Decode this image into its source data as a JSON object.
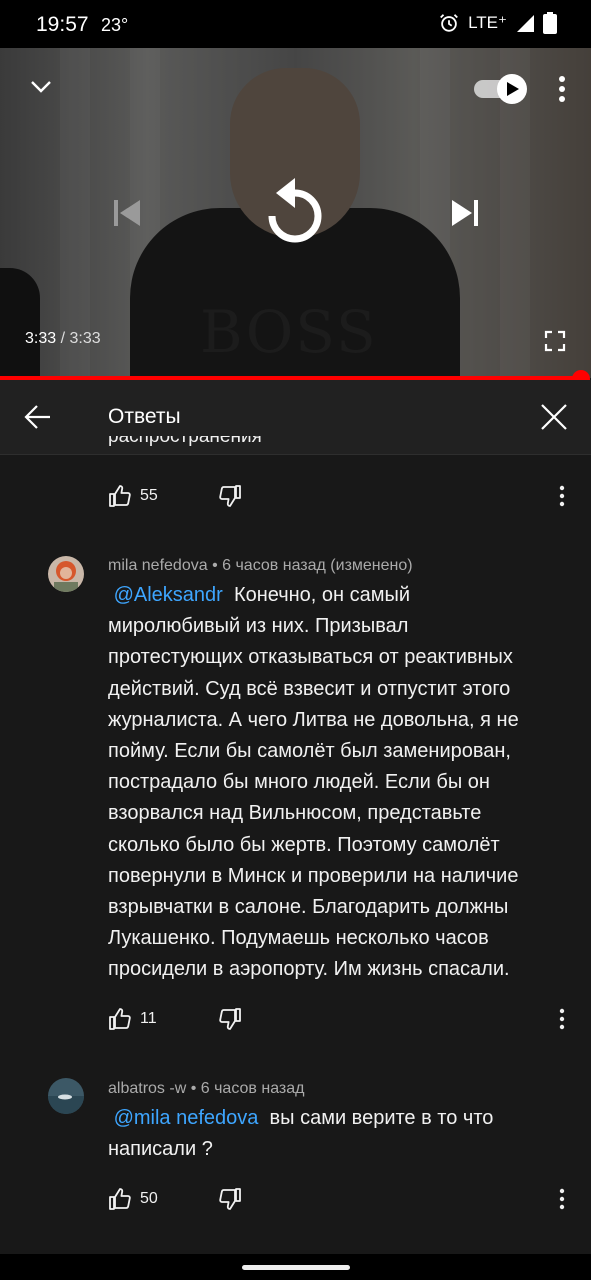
{
  "status_bar": {
    "time": "19:57",
    "temperature": "23°",
    "network": "LTE⁺"
  },
  "video": {
    "current_time": "3:33",
    "separator": " / ",
    "duration": "3:33",
    "progress": 1.0,
    "shirt_text": "BOSS",
    "progress_color": "#ff0000"
  },
  "replies_panel": {
    "title": "Ответы",
    "cut_text": "распространения",
    "top_comment": {
      "likes": "55"
    },
    "replies": [
      {
        "author": "mila nefedova",
        "time": "6 часов назад (изменено)",
        "mention": "@Aleksandr",
        "lines": [
          "Конечно, он самый",
          "миролюбивый из них. Призывал",
          "протестующих отказываться от реактивных",
          "действий. Суд всё взвесит и отпустит этого",
          "журналиста. А чего Литва не довольна, я не",
          "пойму. Если бы самолёт был заменирован,",
          "пострадало бы много людей. Если бы он",
          "взорвался над Вильнюсом, представьте",
          "сколько было бы жертв. Поэтому самолёт",
          "повернули в Минск и проверили на наличие",
          "взрывчатки в салоне. Благодарить должны",
          "Лукашенко.  Подумаешь несколько часов",
          "просидели в аэропорту.  Им жизнь спасали."
        ],
        "likes": "11"
      },
      {
        "author": "albatros -w",
        "time": "6 часов назад",
        "mention": "@mila nefedova",
        "lines": [
          "вы сами верите в то что",
          "написали ?"
        ],
        "likes": "50"
      }
    ]
  },
  "icons": {
    "collapse": "chevron-down-icon",
    "autoplay": "autoplay-toggle-icon",
    "menu": "more-vert-icon",
    "previous": "skip-previous-icon",
    "replay": "replay-icon",
    "next": "skip-next-icon",
    "fullscreen": "fullscreen-icon",
    "back": "arrow-back-icon",
    "close": "close-icon",
    "like": "thumb-up-icon",
    "dislike": "thumb-down-icon"
  },
  "colors": {
    "background": "#181818",
    "header": "#212121",
    "mention": "#3ea6ff",
    "accent": "#ff0000"
  }
}
